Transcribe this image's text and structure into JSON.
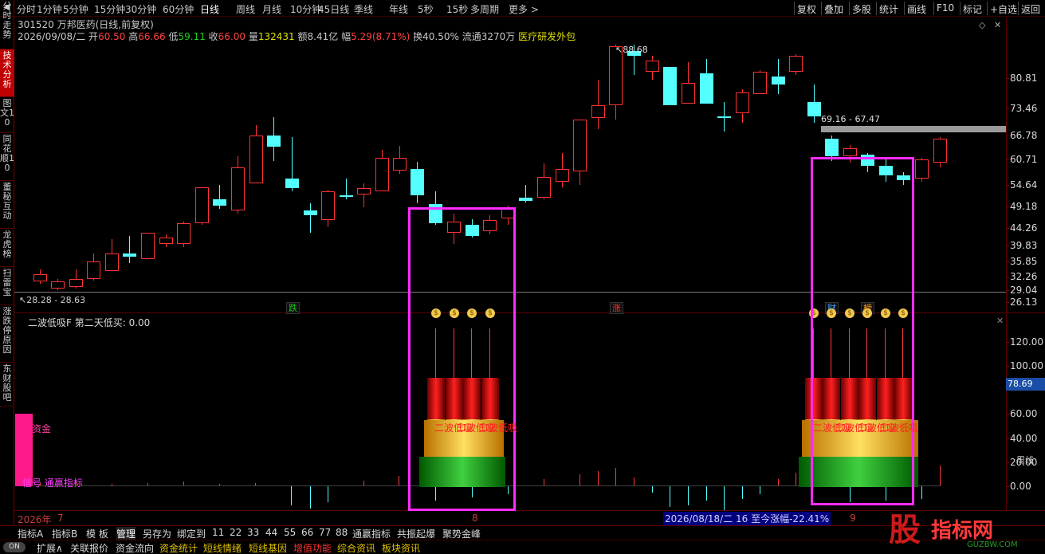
{
  "topbar": {
    "periods": [
      "分时",
      "1分钟",
      "5分钟",
      "15分钟",
      "30分钟",
      "60分钟",
      "日线",
      "周线",
      "月线",
      "10分钟",
      "45日线",
      "季线",
      "年线",
      "5秒",
      "15秒",
      "多周期",
      "更多 >"
    ],
    "active_period": "日线",
    "right_buttons": [
      "复权",
      "叠加",
      "多股",
      "统计",
      "画线",
      "F10",
      "标记",
      "+自选",
      "返回"
    ]
  },
  "sidebar": {
    "tabs": [
      "分时走势",
      "技术分析",
      "图文10",
      "同花顺10",
      "董秘互动",
      "龙虎榜",
      "扫雷宝",
      "涨跌停原因",
      "东财股吧"
    ],
    "active": "技术分析"
  },
  "stock": {
    "title": "301520 万邦医药(日线,前复权)",
    "date": "2026/09/08/二",
    "open_label": "开",
    "open": "60.50",
    "high_label": "高",
    "high": "66.66",
    "low_label": "低",
    "low": "59.11",
    "close_label": "收",
    "close": "66.00",
    "volume_label": "量",
    "volume": "132431",
    "amount_label": "额",
    "amount": "8.41亿",
    "change_label": "幅",
    "change": "5.29(8.71%)",
    "turnover": "换40.50%",
    "float": "流通3270万",
    "sector": "医疗研发外包"
  },
  "price_axis": [
    "80.81",
    "73.46",
    "66.78",
    "60.71",
    "54.64",
    "49.18",
    "44.26",
    "39.83",
    "35.85",
    "32.26",
    "29.04",
    "26.13"
  ],
  "annotations": {
    "high_mark": "88.68",
    "range_label": "69.16 - 67.47",
    "low_mark": "28.28 - 28.63"
  },
  "events": [
    {
      "text": "跌",
      "color": "#20c020"
    },
    {
      "text": "涨",
      "color": "#ff3030"
    },
    {
      "text": "财",
      "color": "#40a0ff"
    },
    {
      "text": "榜",
      "color": "#ffa020"
    }
  ],
  "indicator": {
    "title": "二波低吸F",
    "value_text": "第二天低买: 0.00",
    "axis": [
      "120.00",
      "100.00",
      "78.69",
      "60.00",
      "40.00",
      "20.00",
      "0.00"
    ],
    "current_value": "78.69",
    "legend_fund": "资金",
    "legend_signal": "信号 通赢指标",
    "signal_text": "二波低吸",
    "signal_text_2": "二波低吸"
  },
  "date_axis": {
    "year": "2026年",
    "months": [
      "7",
      "8",
      "9"
    ],
    "range_info": "2026/08/18/二 16 至今涨幅-22.41%"
  },
  "bottom_tabs": [
    "指标A",
    "指标B",
    "模 板",
    "管理",
    "另存为",
    "绑定到",
    "11",
    "22",
    "33",
    "44",
    "55",
    "66",
    "77",
    "88",
    "通赢指标",
    "共振起爆",
    "聚势金峰"
  ],
  "bottom_active": "管理",
  "bar2": {
    "expand": "扩展∧",
    "items": [
      "关联报价",
      "资金流向",
      "资金统计",
      "短线情绪",
      "短线基因",
      "增值功能",
      "综合资讯",
      "板块资讯"
    ]
  },
  "watermark": {
    "text1": "股",
    "text2": "指标网",
    "url": "GUZBW.COM"
  },
  "corner_text": "周线",
  "colors": {
    "up": "#ff3232",
    "down": "#54ffff",
    "box": "#ff2bff",
    "frame": "#5a0000"
  }
}
